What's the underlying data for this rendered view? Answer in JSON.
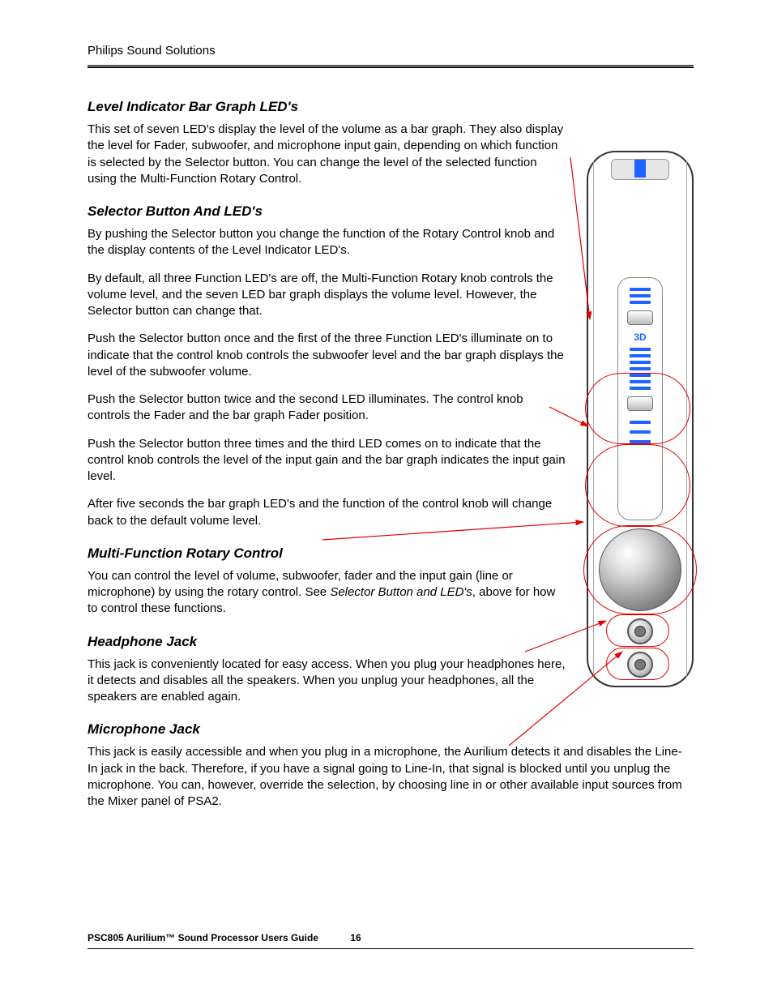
{
  "header": {
    "running": "Philips Sound Solutions"
  },
  "sections": {
    "level": {
      "title": "Level Indicator Bar Graph LED's",
      "p1": "This set of seven LED's display the level of the volume as a bar graph. They also display the level for Fader, subwoofer, and microphone input gain, depending on which function is selected by the Selector button. You can change the level of the selected function using the Multi-Function Rotary Control."
    },
    "selector": {
      "title": "Selector Button And LED's",
      "p1": "By pushing the Selector button you change the function of the Rotary Control knob and the display contents of the Level Indicator LED's.",
      "p2": "By default, all three Function LED's are off, the Multi-Function Rotary knob controls the volume level, and the seven LED bar graph displays the volume level. However, the Selector button can change that.",
      "p3": "Push the Selector button once and the first of the three Function LED's illuminate on to indicate that the control knob controls the subwoofer level and the bar graph displays the level of the subwoofer volume.",
      "p4": "Push the Selector button twice and the second LED illuminates. The control knob controls the Fader and the bar graph Fader position.",
      "p5": "Push the Selector button three times and the third LED comes on to indicate that the control knob controls the level of the input gain and the bar graph indicates the input gain level.",
      "p6": "After five seconds the bar graph LED's and the function of the control knob will change back to the default volume level."
    },
    "rotary": {
      "title": "Multi-Function Rotary Control",
      "p1a": "You can control the level of volume, subwoofer, fader and the input gain (line or microphone) by using the rotary control. See ",
      "p1ref": "Selector Button and LED's",
      "p1b": ", above for how to control these functions."
    },
    "hp": {
      "title": "Headphone Jack",
      "p1": "This jack is conveniently located for easy access. When you plug your headphones here, it detects and disables all the speakers. When you unplug your headphones, all the speakers are enabled again."
    },
    "mic": {
      "title": "Microphone Jack",
      "p1": "This jack is easily accessible and when you plug in a microphone, the Aurilium detects it and disables the Line-In jack in the back. Therefore, if you have a signal going to Line-In, that signal is blocked until you unplug the microphone. You can, however, override the selection, by choosing line in or other available input sources from the Mixer panel of PSA2."
    }
  },
  "device": {
    "label_3d": "3D"
  },
  "footer": {
    "title": "PSC805 Aurilium™ Sound Processor Users Guide",
    "page": "16"
  }
}
